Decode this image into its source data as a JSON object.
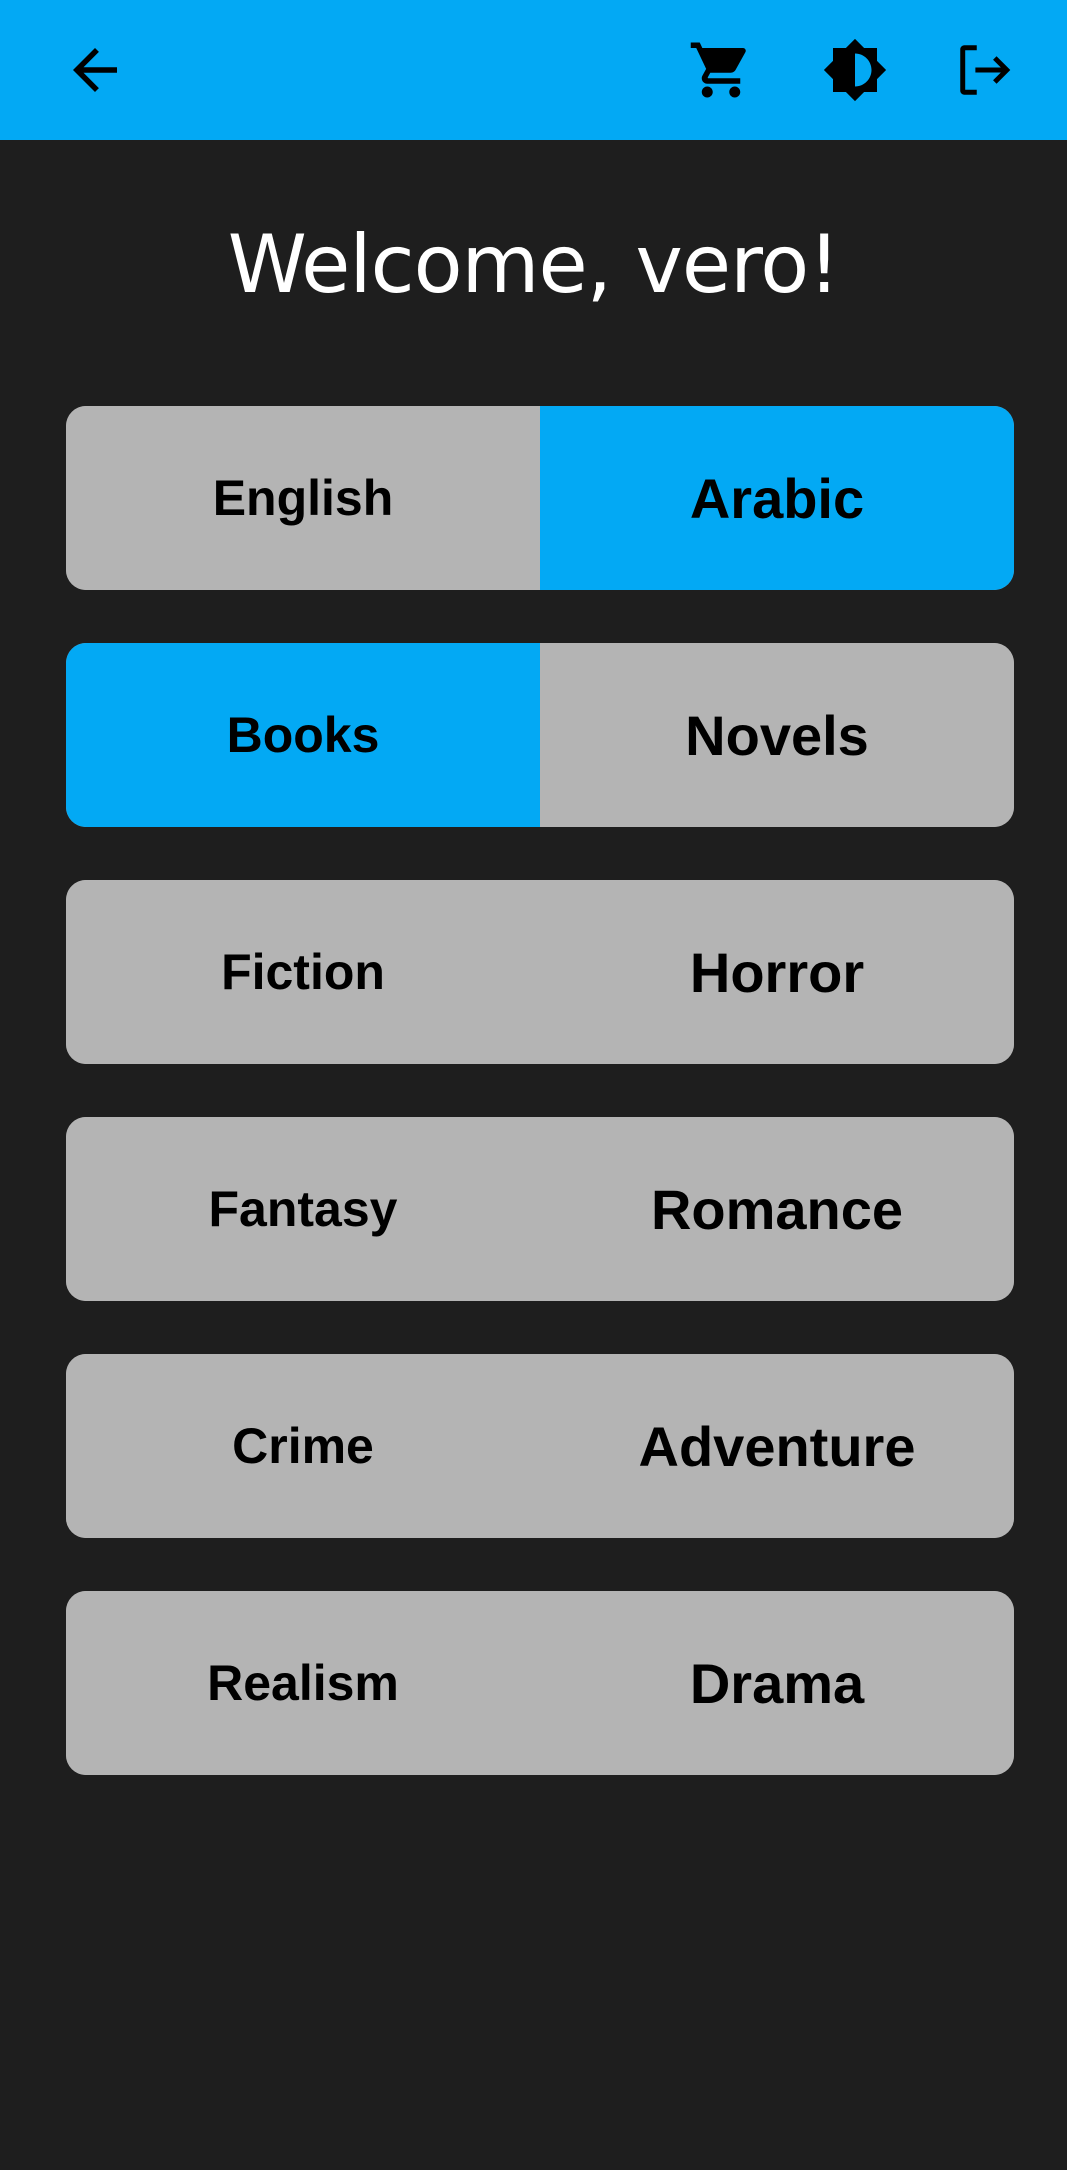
{
  "app_bar": {
    "back_icon": "arrow-left-icon",
    "cart_icon": "shopping-cart-icon",
    "theme_icon": "brightness-contrast-icon",
    "logout_icon": "logout-icon",
    "background_color": "#03a9f4"
  },
  "welcome": {
    "title": "Welcome, vero!"
  },
  "language_toggle": {
    "options": [
      "English",
      "Arabic"
    ],
    "selected": "Arabic"
  },
  "type_toggle": {
    "options": [
      "Books",
      "Novels"
    ],
    "selected": "Books"
  },
  "genres": [
    {
      "left": "Fiction",
      "right": "Horror"
    },
    {
      "left": "Fantasy",
      "right": "Romance"
    },
    {
      "left": "Crime",
      "right": "Adventure"
    },
    {
      "left": "Realism",
      "right": "Drama"
    }
  ],
  "colors": {
    "accent": "#03a9f4",
    "background": "#1e1e1e",
    "unselected": "#b4b4b4",
    "text": "#000000",
    "title_text": "#ffffff"
  }
}
